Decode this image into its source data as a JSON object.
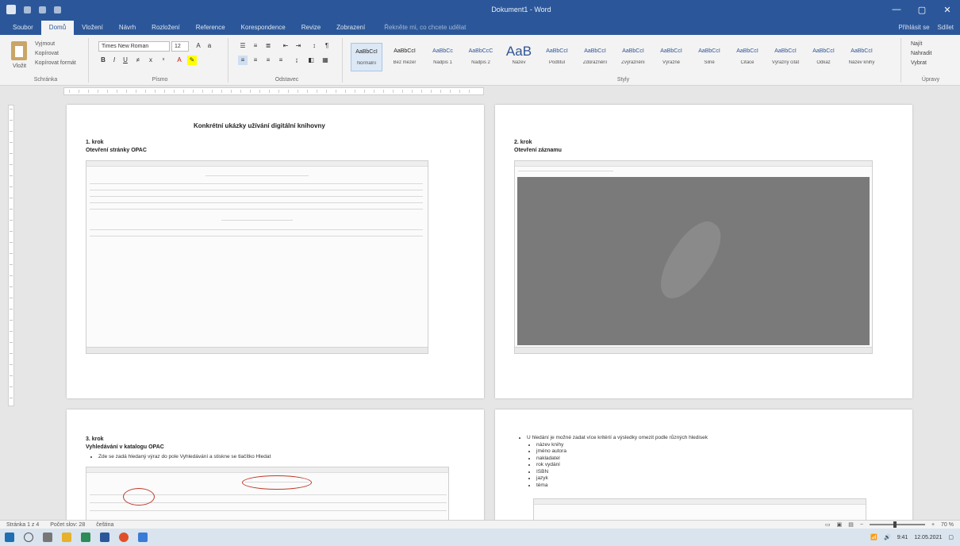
{
  "titlebar": {
    "title": "Dokument1 - Word",
    "min": "—",
    "max": "▢",
    "close": "✕"
  },
  "tabs": [
    "Soubor",
    "Domů",
    "Vložení",
    "Návrh",
    "Rozložení",
    "Reference",
    "Korespondence",
    "Revize",
    "Zobrazení"
  ],
  "active_tab": 1,
  "tell_me": "Řekněte mi, co chcete udělat",
  "tabs_right": [
    "Přihlásit se",
    "Sdílet"
  ],
  "ribbon": {
    "clipboard": {
      "label": "Schránka",
      "paste": "Vložit",
      "cut": "Vyjmout",
      "copy": "Kopírovat",
      "painter": "Kopírovat formát"
    },
    "font": {
      "label": "Písmo",
      "name": "Times New Roman",
      "size": "12"
    },
    "paragraph": {
      "label": "Odstavec"
    },
    "styles": {
      "label": "Styly",
      "items": [
        {
          "preview": "AaBbCcI",
          "name": "Normální"
        },
        {
          "preview": "AaBbCcI",
          "name": "Bez mezer"
        },
        {
          "preview": "AaBbCc",
          "name": "Nadpis 1"
        },
        {
          "preview": "AaBbCcC",
          "name": "Nadpis 2"
        },
        {
          "preview": "AaB",
          "name": "Název"
        },
        {
          "preview": "AaBbCcI",
          "name": "Podtitul"
        },
        {
          "preview": "AaBbCcI",
          "name": "Zdůraznění"
        },
        {
          "preview": "AaBbCcI",
          "name": "Zvýraznění"
        },
        {
          "preview": "AaBbCcI",
          "name": "Výrazné"
        },
        {
          "preview": "AaBbCcI",
          "name": "Silné"
        },
        {
          "preview": "AaBbCcI",
          "name": "Citace"
        },
        {
          "preview": "AaBbCcI",
          "name": "Výrazný citát"
        },
        {
          "preview": "AaBbCcI",
          "name": "Odkaz"
        },
        {
          "preview": "AaBbCcI",
          "name": "Název knihy"
        }
      ]
    },
    "editing": {
      "label": "Úpravy",
      "find": "Najít",
      "replace": "Nahradit",
      "select": "Vybrat"
    }
  },
  "page1": {
    "title": "Konkrétní ukázky užívání digitální knihovny",
    "step": "1. krok",
    "caption": "Otevření stránky OPAC"
  },
  "page2": {
    "step": "2. krok",
    "caption": "Otevření záznamu"
  },
  "page3": {
    "step": "3. krok",
    "caption": "Vyhledávání v katalogu OPAC",
    "bullet": "Zde se zadá hledaný výraz do pole Vyhledávání a stiskne se tlačítko Hledat"
  },
  "page4": {
    "bullet": "U hledání je možné zadat více kritérií a výsledky omezit podle různých hledisek",
    "sub": [
      "název knihy",
      "jméno autora",
      "nakladatel",
      "rok vydání",
      "ISBN",
      "jazyk",
      "téma"
    ]
  },
  "status": {
    "page": "Stránka 1 z 4",
    "words": "Počet slov: 28",
    "lang": "čeština",
    "zoom": "70 %"
  },
  "tray": {
    "time": "9:41",
    "date": "12.05.2021"
  }
}
